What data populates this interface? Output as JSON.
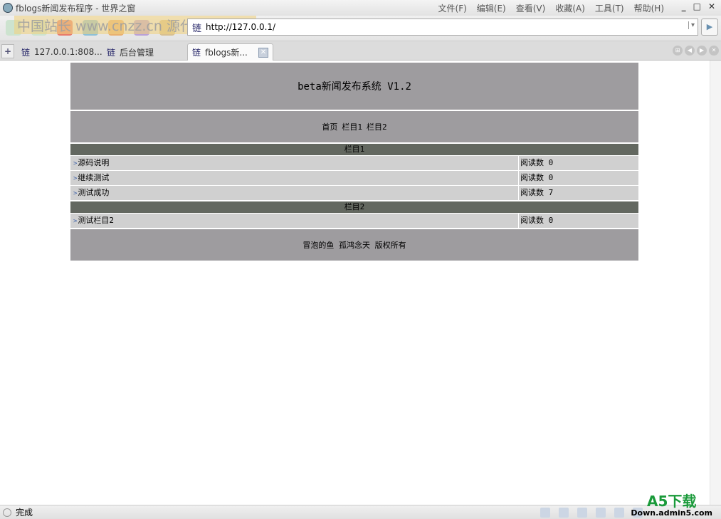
{
  "window": {
    "title": "fblogs新闻发布程序 - 世界之窗",
    "menu": [
      "文件(F)",
      "编辑(E)",
      "查看(V)",
      "收藏(A)",
      "工具(T)",
      "帮助(H)"
    ],
    "controls": [
      "_",
      "□",
      "✕"
    ]
  },
  "toolbar": {
    "watermark": "中国站长 www.cnzz.cn 源代码调试截图",
    "address": "http://127.0.0.1/",
    "fav_glyph": "链"
  },
  "tabs": [
    {
      "label": "127.0.0.1:808..."
    },
    {
      "label": "后台管理"
    },
    {
      "label": "fblogs新...",
      "active": true
    }
  ],
  "page": {
    "title": "beta新闻发布系统 V1.2",
    "nav": [
      "首页",
      "栏目1",
      "栏目2"
    ],
    "sections": [
      {
        "name": "栏目1",
        "items": [
          {
            "title": "源码说明",
            "reads_label": "阅读数",
            "reads": "0"
          },
          {
            "title": "继续测试",
            "reads_label": "阅读数",
            "reads": "0"
          },
          {
            "title": "测试成功",
            "reads_label": "阅读数",
            "reads": "7"
          }
        ]
      },
      {
        "name": "栏目2",
        "items": [
          {
            "title": "测试栏目2",
            "reads_label": "阅读数",
            "reads": "0"
          }
        ]
      }
    ],
    "footer": "冒泡的鱼 孤鸿念天 版权所有"
  },
  "status": {
    "text": "完成",
    "brand": "A5下载",
    "brand_sub": "Down.admin5.com"
  }
}
